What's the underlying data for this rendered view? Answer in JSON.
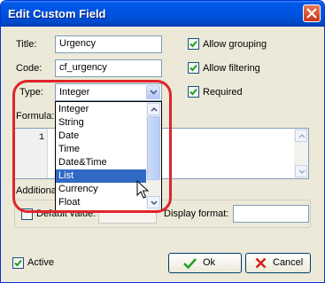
{
  "window": {
    "title": "Edit Custom Field",
    "close_icon": "close-icon"
  },
  "fields": {
    "title_label": "Title:",
    "title_value": "Urgency",
    "code_label": "Code:",
    "code_value": "cf_urgency",
    "type_label": "Type:",
    "type_value": "Integer",
    "formula_label": "Formula:",
    "editor_line_number": "1"
  },
  "options": {
    "allow_grouping": {
      "label": "Allow grouping",
      "checked": true
    },
    "allow_filtering": {
      "label": "Allow filtering",
      "checked": true
    },
    "required": {
      "label": "Required",
      "checked": true
    }
  },
  "type_dropdown": {
    "items": [
      "Integer",
      "String",
      "Date",
      "Time",
      "Date&Time",
      "List",
      "Currency",
      "Float"
    ],
    "selected": "List"
  },
  "additional": {
    "group_label": "Additional",
    "default_value_label": "Default value:",
    "display_format_label": "Display format:",
    "display_format_value": ""
  },
  "footer": {
    "active_label": "Active",
    "ok_label": "Ok",
    "cancel_label": "Cancel"
  },
  "colors": {
    "title_bar": "#0054e3",
    "selection": "#316ac5",
    "highlight": "#e0242a",
    "window_bg": "#ece9d8"
  }
}
